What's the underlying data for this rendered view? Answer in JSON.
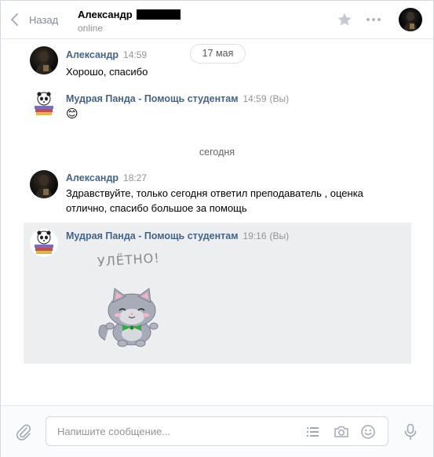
{
  "header": {
    "back_label": "Назад",
    "peer_name": "Александр",
    "peer_status": "online"
  },
  "feed": {
    "date_pill": "17 мая",
    "today_divider": "сегодня"
  },
  "messages": [
    {
      "author": "Александр",
      "time": "14:59",
      "you": "",
      "text": "Хорошо, спасибо"
    },
    {
      "author": "Мудрая Панда - Помощь студентам",
      "time": "14:59",
      "you": "(Вы)",
      "text": "😊"
    },
    {
      "author": "Александр",
      "time": "18:27",
      "you": "",
      "text_line1": "Здравствуйте, только сегодня ответил преподаватель , оценка",
      "text_line2": "отлично, спасибо большое за помощь"
    },
    {
      "author": "Мудрая Панда - Помощь студентам",
      "time": "19:16",
      "you": "(Вы)",
      "sticker_caption": "УЛЁТНО!"
    }
  ],
  "composer": {
    "placeholder": "Напишите сообщение..."
  },
  "icons": {
    "back": "chevron-left-icon",
    "favorite": "star-icon",
    "more": "more-horizontal-icon",
    "attach": "paperclip-icon",
    "templates": "list-icon",
    "camera": "camera-icon",
    "emoji": "smile-icon",
    "voice": "microphone-icon"
  },
  "colors": {
    "author_link": "#42648b",
    "muted": "#939393",
    "highlight_bg": "#edeef0"
  }
}
